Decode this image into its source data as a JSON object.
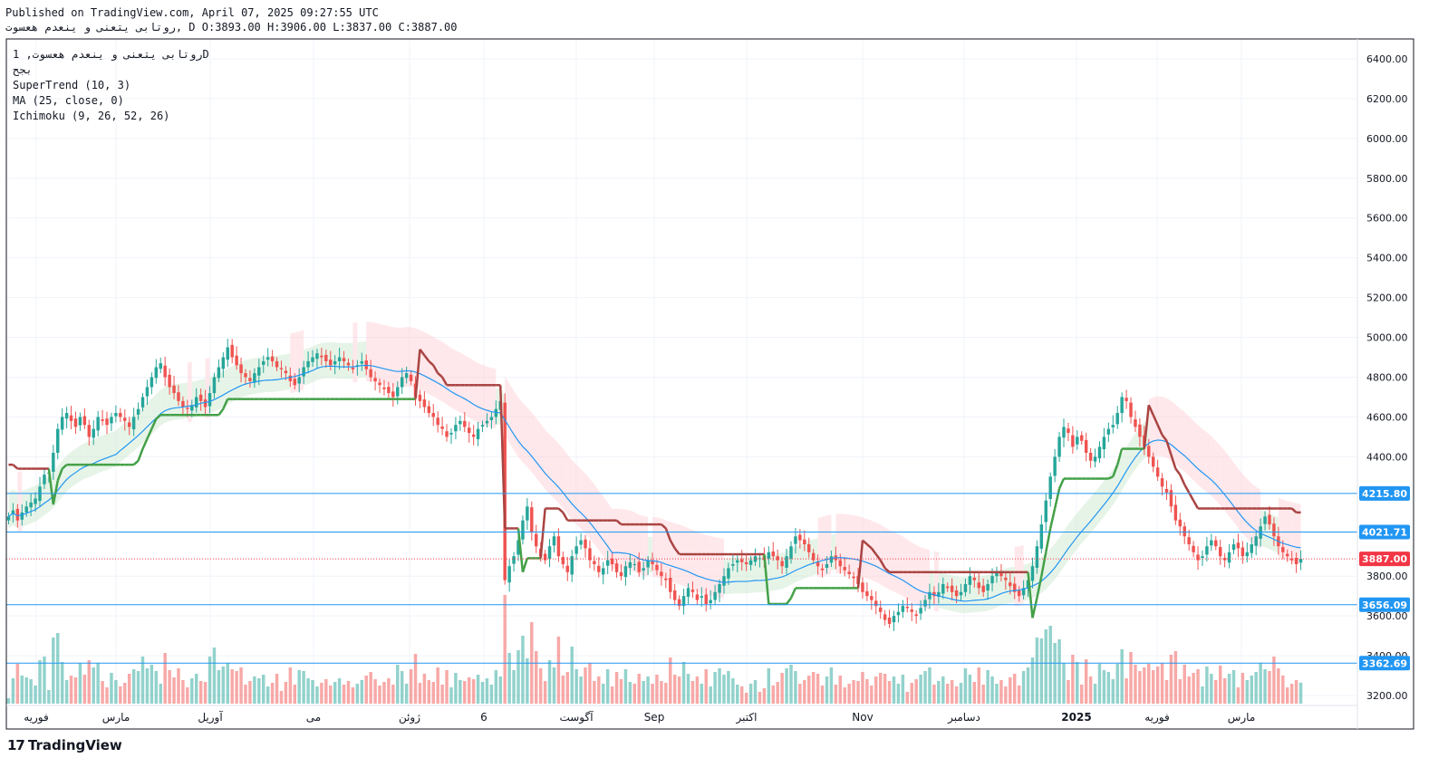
{
  "header": {
    "published": "Published on TradingView.com, April 07, 2025 09:27:55 UTC",
    "symbol_line": "روتابی یتعنی و ینعدم هعسوت, D O:3893.00 H:3906.00 L:3837.00 C:3887.00"
  },
  "legend": {
    "title": "روتابی یتعنی و ینعدم هعسوت, 1D",
    "exchange": "بجح",
    "supertrend": "SuperTrend (10, 3)",
    "ma": "MA (25, close, 0)",
    "ichimoku": "Ichimoku (9, 26, 52, 26)"
  },
  "brand": {
    "logo_text": "17",
    "name": "TradingView"
  },
  "colors": {
    "up": "#26a69a",
    "down": "#ef5350",
    "supertrend_up": "#43a047",
    "supertrend_down": "#a94442",
    "ma": "#2196f3",
    "hline": "#2196f3",
    "last_price": "#f23645",
    "cloud_green": "#c8e6c9",
    "cloud_red": "#ffcdd2"
  },
  "chart_data": {
    "type": "candlestick",
    "ylim": [
      3150,
      6500
    ],
    "y_ticks": [
      "6400.00",
      "6200.00",
      "6000.00",
      "5800.00",
      "5600.00",
      "5400.00",
      "5200.00",
      "5000.00",
      "4800.00",
      "4600.00",
      "4400.00",
      "3800.00",
      "3600.00",
      "3400.00",
      "3200.00"
    ],
    "x_ticks": [
      "فوریه",
      "مارس",
      "آوریل",
      "می",
      "ژوئن",
      "6",
      "آگوست",
      "Sep",
      "اکتبر",
      "Nov",
      "دسامبر",
      "2025",
      "فوریه",
      "مارس"
    ],
    "horizontal_levels": [
      {
        "value": 4215.8,
        "label": "4215.80"
      },
      {
        "value": 4021.71,
        "label": "4021.71"
      },
      {
        "value": 3656.09,
        "label": "3656.09"
      },
      {
        "value": 3362.69,
        "label": "3362.69"
      }
    ],
    "last_price": {
      "value": 3887.0,
      "label": "3887.00"
    },
    "ohlc_last": {
      "open": 3893.0,
      "high": 3906.0,
      "low": 3837.0,
      "close": 3887.0
    },
    "close": [
      4100,
      4130,
      4080,
      4120,
      4150,
      4170,
      4190,
      4250,
      4310,
      4320,
      4420,
      4540,
      4600,
      4620,
      4580,
      4550,
      4600,
      4560,
      4500,
      4540,
      4600,
      4580,
      4560,
      4600,
      4620,
      4600,
      4580,
      4550,
      4600,
      4640,
      4700,
      4750,
      4800,
      4850,
      4870,
      4800,
      4750,
      4720,
      4680,
      4650,
      4640,
      4660,
      4700,
      4680,
      4650,
      4720,
      4800,
      4850,
      4900,
      4950,
      4900,
      4860,
      4820,
      4800,
      4780,
      4820,
      4850,
      4880,
      4900,
      4880,
      4850,
      4840,
      4820,
      4780,
      4760,
      4800,
      4850,
      4880,
      4900,
      4920,
      4900,
      4880,
      4860,
      4880,
      4900,
      4880,
      4860,
      4840,
      4860,
      4880,
      4840,
      4800,
      4780,
      4760,
      4740,
      4720,
      4700,
      4750,
      4800,
      4820,
      4780,
      4700,
      4680,
      4650,
      4620,
      4600,
      4560,
      4540,
      4500,
      4520,
      4560,
      4580,
      4550,
      4520,
      4500,
      4540,
      4560,
      4580,
      4600,
      4640,
      4680,
      3780,
      3850,
      3900,
      3980,
      4080,
      4150,
      4020,
      3950,
      3900,
      3880,
      3950,
      4000,
      3900,
      3860,
      3820,
      3900,
      3950,
      3980,
      3940,
      3880,
      3860,
      3820,
      3840,
      3880,
      3860,
      3820,
      3800,
      3850,
      3870,
      3860,
      3820,
      3840,
      3880,
      3860,
      3830,
      3800,
      3780,
      3720,
      3680,
      3650,
      3700,
      3740,
      3720,
      3680,
      3700,
      3660,
      3680,
      3720,
      3760,
      3800,
      3840,
      3860,
      3880,
      3870,
      3860,
      3880,
      3900,
      3890,
      3880,
      3920,
      3900,
      3880,
      3850,
      3900,
      3950,
      4000,
      3980,
      3960,
      3920,
      3880,
      3850,
      3830,
      3860,
      3900,
      3880,
      3850,
      3830,
      3810,
      3790,
      3760,
      3720,
      3700,
      3680,
      3650,
      3620,
      3580,
      3560,
      3600,
      3620,
      3650,
      3640,
      3620,
      3600,
      3640,
      3680,
      3720,
      3700,
      3720,
      3760,
      3740,
      3720,
      3700,
      3720,
      3760,
      3800,
      3780,
      3740,
      3720,
      3760,
      3800,
      3820,
      3800,
      3780,
      3750,
      3720,
      3700,
      3740,
      3780,
      3850,
      3950,
      4060,
      4180,
      4300,
      4400,
      4500,
      4550,
      4520,
      4450,
      4500,
      4480,
      4420,
      4380,
      4400,
      4450,
      4500,
      4540,
      4560,
      4620,
      4700,
      4680,
      4600,
      4550,
      4500,
      4450,
      4400,
      4350,
      4300,
      4250,
      4220,
      4150,
      4080,
      4050,
      4000,
      3960,
      3920,
      3880,
      3900,
      3950,
      3980,
      3950,
      3900,
      3880,
      3920,
      3960,
      3940,
      3900,
      3920,
      3960,
      4000,
      4050,
      4100,
      4060,
      4000,
      3950,
      3920,
      3900,
      3880,
      3860,
      3887
    ],
    "volume_note": "volume histogram bars along bottom"
  }
}
